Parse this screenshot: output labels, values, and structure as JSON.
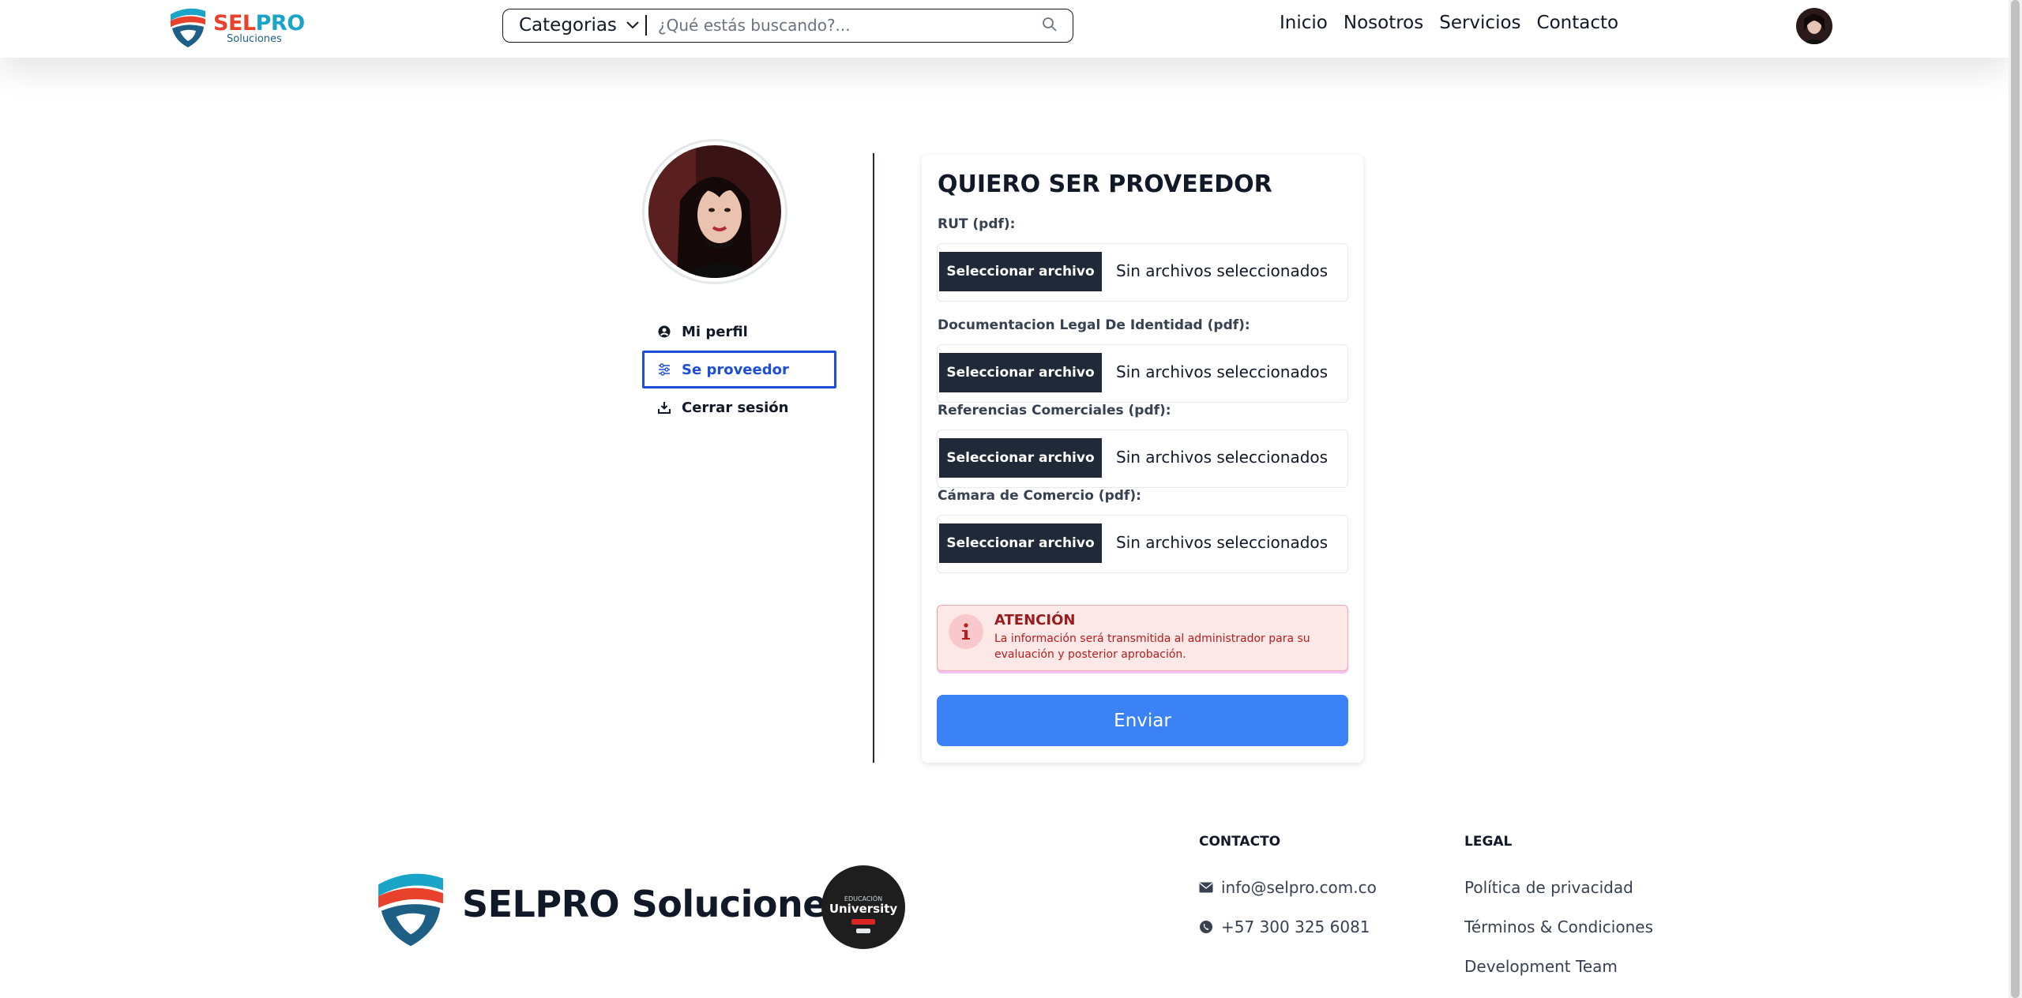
{
  "header": {
    "brand_sel": "SEL",
    "brand_pro": "PRO",
    "brand_sub": "Soluciones",
    "categories_label": "Categorias",
    "search_placeholder": "¿Qué estás buscando?...",
    "nav": [
      "Inicio",
      "Nosotros",
      "Servicios",
      "Contacto"
    ]
  },
  "sidebar": {
    "items": [
      {
        "label": "Mi perfil",
        "icon": "user-circle-icon",
        "active": false
      },
      {
        "label": "Se proveedor",
        "icon": "sliders-icon",
        "active": true
      },
      {
        "label": "Cerrar sesión",
        "icon": "logout-icon",
        "active": false
      }
    ]
  },
  "form": {
    "title": "QUIERO SER PROVEEDOR",
    "fields": [
      {
        "label": "RUT (pdf):",
        "button": "Seleccionar archivo",
        "status": "Sin archivos seleccionados"
      },
      {
        "label": "Documentacion Legal De Identidad (pdf):",
        "button": "Seleccionar archivo",
        "status": "Sin archivos seleccionados"
      },
      {
        "label": "Referencias Comerciales (pdf):",
        "button": "Seleccionar archivo",
        "status": "Sin archivos seleccionados"
      },
      {
        "label": "Cámara de Comercio (pdf):",
        "button": "Seleccionar archivo",
        "status": "Sin archivos seleccionados"
      }
    ],
    "alert_title": "ATENCIÓN",
    "alert_text": "La información será transmitida al administrador para su evaluación y posterior aprobación.",
    "submit_label": "Enviar"
  },
  "footer": {
    "brand": "SELPRO Soluciones",
    "badge_top": "EDUCACIÓN",
    "badge_main": "University",
    "contact_title": "CONTACTO",
    "email": "info@selpro.com.co",
    "phone": "+57 300 325 6081",
    "legal_title": "LEGAL",
    "legal_links": [
      "Política de privacidad",
      "Términos & Condiciones",
      "Development Team"
    ]
  },
  "colors": {
    "primary_button": "#3b82f6",
    "file_button": "#1f2937",
    "active_sidebar": "#1d4ed8",
    "alert_bg": "#fde8e8",
    "brand_red": "#e8412c",
    "brand_blue": "#1aa4c8"
  }
}
